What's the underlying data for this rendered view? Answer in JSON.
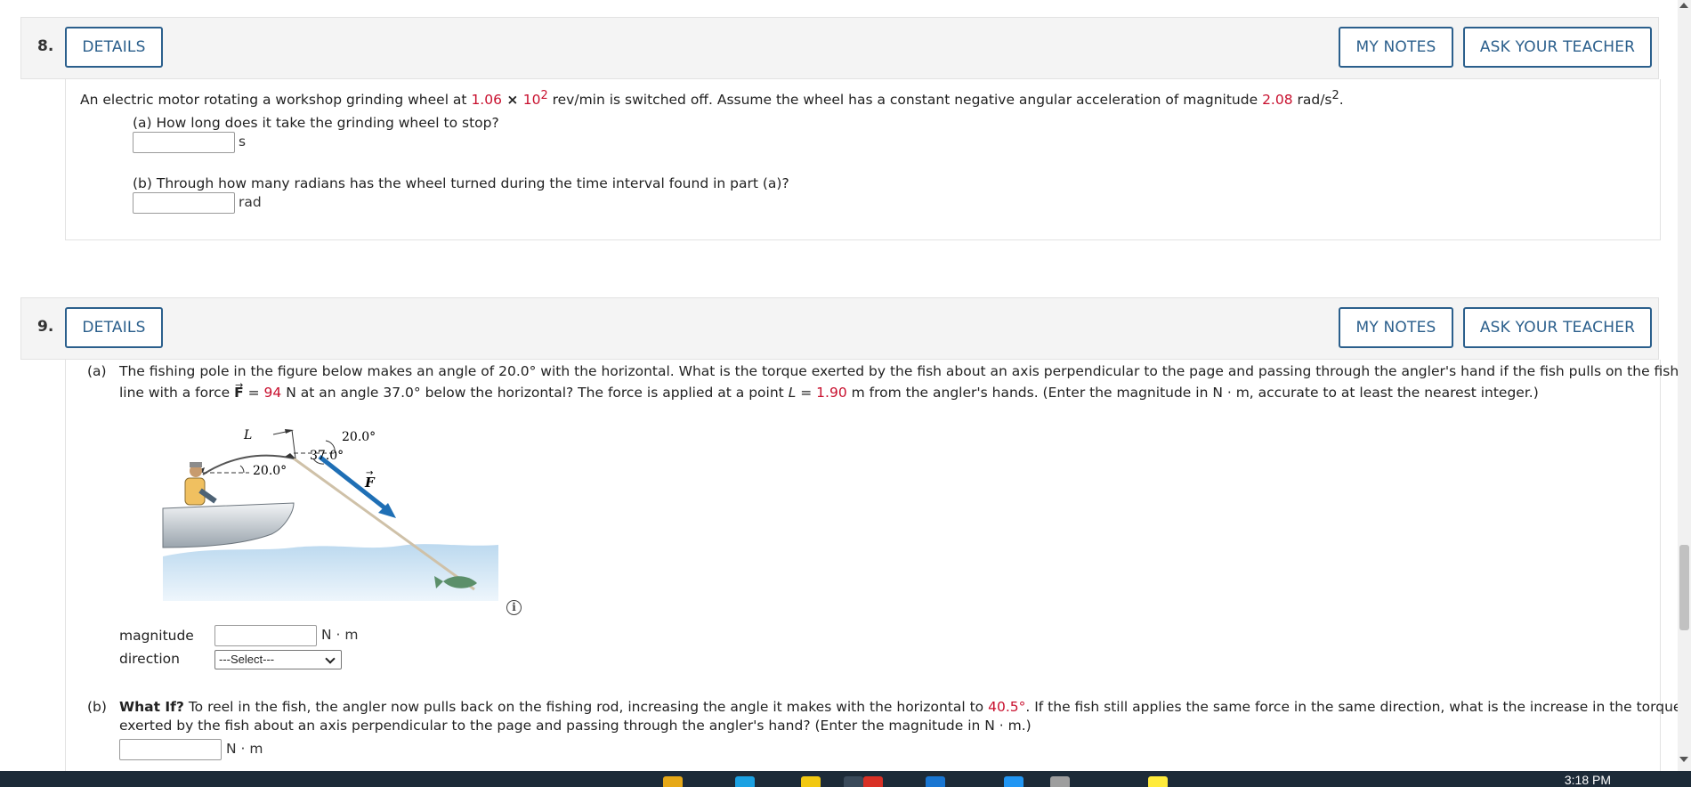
{
  "q8": {
    "number": "8.",
    "details": "DETAILS",
    "my_notes": "MY NOTES",
    "ask": "ASK YOUR TEACHER",
    "prompt_start": "An electric motor rotating a workshop grinding wheel at ",
    "speed_value": "1.06",
    "times": " × ",
    "speed_pow_base": "10",
    "speed_pow_exp": "2",
    "prompt_mid": " rev/min is switched off. Assume the wheel has a constant negative angular acceleration of magnitude ",
    "accel_value": "2.08",
    "prompt_end": " rad/s",
    "accel_exp": "2",
    "period": ".",
    "part_a": "(a) How long does it take the grinding wheel to stop?",
    "unit_a": "s",
    "part_b": "(b) Through how many radians has the wheel turned during the time interval found in part (a)?",
    "unit_b": "rad"
  },
  "q9": {
    "number": "9.",
    "details": "DETAILS",
    "my_notes": "MY NOTES",
    "ask": "ASK YOUR TEACHER",
    "a_label": "(a)",
    "a_line1": "The fishing pole in the figure below makes an angle of 20.0° with the horizontal. What is the torque exerted by the fish about an axis perpendicular to the page and passing through the angler's hand if the fish pulls on the fishing",
    "a_line2_start": "line with a force ",
    "a_force_symbol": "F",
    "a_line2_eq": " = ",
    "a_force_value": "94",
    "a_line2_mid": " N at an angle 37.0° below the horizontal? The force is applied at a point ",
    "a_L": "L",
    "a_line2_eq2": " = ",
    "a_L_value": "1.90",
    "a_line2_end": " m from the angler's hands. (Enter the magnitude in N · m, accurate to at least the nearest integer.)",
    "figure": {
      "label_L": "L",
      "angle_top": "20.0°",
      "angle_force": "37.0°",
      "angle_pole": "20.0°",
      "force_label": "F"
    },
    "magnitude_label": "magnitude",
    "magnitude_unit": "N · m",
    "direction_label": "direction",
    "direction_selected": "---Select---",
    "b_label": "(b)",
    "b_bold": "What If?",
    "b_line1_start": " To reel in the fish, the angler now pulls back on the fishing rod, increasing the angle it makes with the horizontal to ",
    "b_angle": "40.5°",
    "b_line1_end": ". If the fish still applies the same force in the same direction, what is the increase in the torque",
    "b_line2": "exerted by the fish about an axis perpendicular to the page and passing through the angler's hand? (Enter the magnitude in N · m.)",
    "b_unit": "N · m"
  },
  "taskbar": {
    "clock": "3:18 PM"
  },
  "colors": {
    "accent": "#2b5f8c",
    "highlight": "#c8102e",
    "force_arrow": "#1f6fb5"
  }
}
